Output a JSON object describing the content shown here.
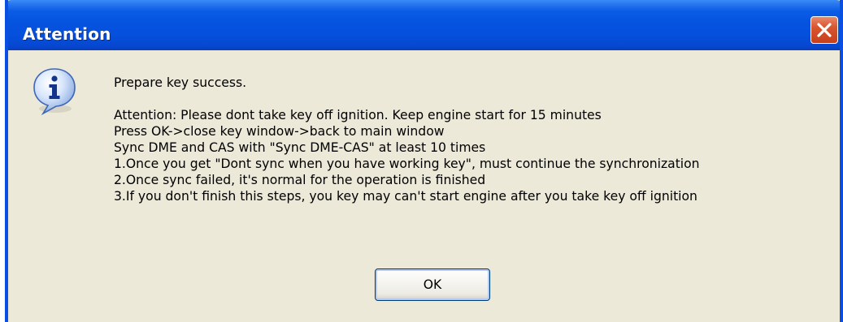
{
  "window": {
    "title": "Attention",
    "close_icon": "close-icon",
    "colors": {
      "titlebar": "#0553df",
      "body": "#ece9d8",
      "close_button": "#d9552f"
    }
  },
  "dialog": {
    "icon": "info-icon",
    "lines": [
      "Prepare key success.",
      "",
      "Attention: Please dont take key off ignition. Keep engine start for 15 minutes",
      "Press OK->close key window->back to main window",
      "Sync DME and CAS with \"Sync DME-CAS\" at least 10 times",
      "1.Once you get \"Dont sync when you have working key\", must continue the synchronization",
      "2.Once sync failed, it's normal for the operation is finished",
      "3.If you don't finish this steps, you key may can't start engine after you take key off ignition"
    ],
    "ok_label": "OK"
  }
}
